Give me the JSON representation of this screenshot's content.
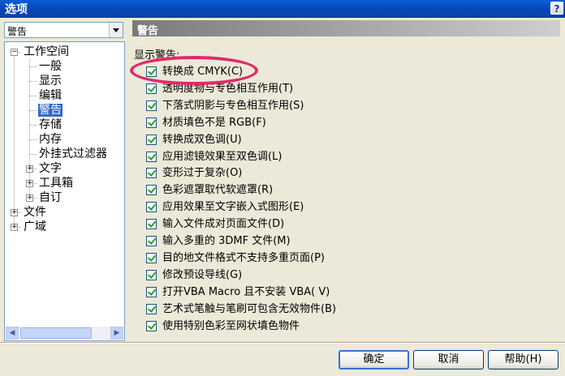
{
  "window": {
    "title": "选项",
    "help_glyph": "?"
  },
  "category_select": {
    "value": "警告"
  },
  "tree": [
    {
      "label": "工作空间",
      "level": 0,
      "expander": "−",
      "selected": false
    },
    {
      "label": "一般",
      "level": 1,
      "expander": "",
      "selected": false
    },
    {
      "label": "显示",
      "level": 1,
      "expander": "",
      "selected": false
    },
    {
      "label": "编辑",
      "level": 1,
      "expander": "",
      "selected": false
    },
    {
      "label": "警告",
      "level": 1,
      "expander": "",
      "selected": true
    },
    {
      "label": "存储",
      "level": 1,
      "expander": "",
      "selected": false
    },
    {
      "label": "内存",
      "level": 1,
      "expander": "",
      "selected": false
    },
    {
      "label": "外挂式过滤器",
      "level": 1,
      "expander": "",
      "selected": false
    },
    {
      "label": "文字",
      "level": 1,
      "expander": "+",
      "selected": false
    },
    {
      "label": "工具箱",
      "level": 1,
      "expander": "+",
      "selected": false
    },
    {
      "label": "自订",
      "level": 1,
      "expander": "+",
      "selected": false
    },
    {
      "label": "文件",
      "level": 0,
      "expander": "+",
      "selected": false
    },
    {
      "label": "广域",
      "level": 0,
      "expander": "+",
      "selected": false
    }
  ],
  "panel": {
    "header": "警告",
    "section_label": "显示警告:",
    "options": [
      {
        "label": "转换成 CMYK(C)",
        "checked": true
      },
      {
        "label": "透明度物与专色相互作用(T)",
        "checked": true
      },
      {
        "label": "下落式阴影与专色相互作用(S)",
        "checked": true
      },
      {
        "label": "材质填色不是 RGB(F)",
        "checked": true
      },
      {
        "label": "转换成双色调(U)",
        "checked": true
      },
      {
        "label": "应用滤镜效果至双色调(L)",
        "checked": true
      },
      {
        "label": "变形过于复杂(O)",
        "checked": true
      },
      {
        "label": "色彩遮罩取代软遮罩(R)",
        "checked": true
      },
      {
        "label": "应用效果至文字嵌入式图形(E)",
        "checked": true
      },
      {
        "label": "输入文件成对页面文件(D)",
        "checked": true
      },
      {
        "label": "输入多重的 3DMF 文件(M)",
        "checked": true
      },
      {
        "label": "目的地文件格式不支持多重页面(P)",
        "checked": true
      },
      {
        "label": "修改预设导线(G)",
        "checked": true
      },
      {
        "label": "打开VBA Macro 且不安装 VBA( V)",
        "checked": true
      },
      {
        "label": "艺术式笔触与笔刷可包含无效物件(B)",
        "checked": true
      },
      {
        "label": "使用特别色彩至网状填色物件",
        "checked": true
      }
    ]
  },
  "buttons": {
    "ok": "确定",
    "cancel": "取消",
    "help": "帮助(H)"
  },
  "colors": {
    "highlight_ellipse": "#e02a6a",
    "title_bar": "#0a5fd6",
    "selection": "#316ac5"
  }
}
